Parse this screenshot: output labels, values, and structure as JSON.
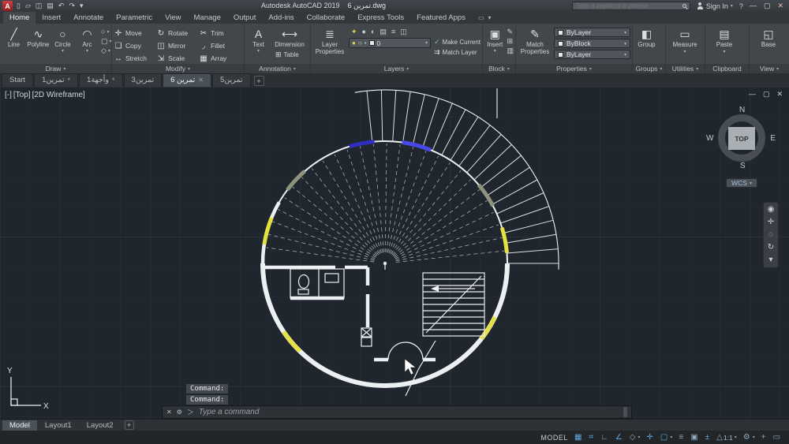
{
  "ui": {
    "caret": "▾",
    "close": "✕",
    "plus": "+"
  },
  "colors": {
    "canvas_bg": "#20262d",
    "wall_white": "#edf0f2",
    "segment_yellow": "#e6e13e",
    "segment_blue": "#4748e8",
    "segment_navy": "#2e2ec0",
    "segment_gray": "#8f927e",
    "status_active": "#62a6df"
  },
  "title_bar": {
    "logo_letter": "A",
    "qat_icons": [
      {
        "glyph": "▯"
      },
      {
        "glyph": "▱"
      },
      {
        "glyph": "◫"
      },
      {
        "glyph": "▤"
      },
      {
        "glyph": "↶"
      },
      {
        "glyph": "↷"
      },
      {
        "glyph": "▾"
      }
    ],
    "app_title": "Autodesk AutoCAD 2019",
    "doc_title": "تمرين 6.dwg",
    "search_placeholder": "Type a keyword or phrase",
    "sign_in_label": "Sign In",
    "help_glyph": "?",
    "window_buttons": {
      "minimize": "—",
      "restore": "▢",
      "close": "✕"
    }
  },
  "ribbon_tabs": [
    {
      "label": "Home",
      "active": true
    },
    {
      "label": "Insert"
    },
    {
      "label": "Annotate"
    },
    {
      "label": "Parametric"
    },
    {
      "label": "View"
    },
    {
      "label": "Manage"
    },
    {
      "label": "Output"
    },
    {
      "label": "Add-ins"
    },
    {
      "label": "Collaborate"
    },
    {
      "label": "Express Tools"
    },
    {
      "label": "Featured Apps"
    }
  ],
  "panels": {
    "draw": {
      "label": "Draw",
      "items": [
        {
          "label": "Line",
          "glyph": "╱"
        },
        {
          "label": "Polyline",
          "glyph": "∿"
        },
        {
          "label": "Circle",
          "glyph": "○",
          "caret": true
        },
        {
          "label": "Arc",
          "glyph": "◠",
          "caret": true
        }
      ],
      "extra_icons": [
        {
          "glyph": "○"
        },
        {
          "glyph": "▢"
        },
        {
          "glyph": "◇"
        }
      ]
    },
    "modify": {
      "label": "Modify",
      "items": [
        {
          "label": "Move",
          "glyph": "✛"
        },
        {
          "label": "Rotate",
          "glyph": "↻"
        },
        {
          "label": "Trim",
          "glyph": "✂"
        },
        {
          "label": "Copy",
          "glyph": "❏"
        },
        {
          "label": "Mirror",
          "glyph": "◫"
        },
        {
          "label": "Fillet",
          "glyph": "◞"
        },
        {
          "label": "Stretch",
          "glyph": "↔"
        },
        {
          "label": "Scale",
          "glyph": "⇲"
        },
        {
          "label": "Array",
          "glyph": "▦"
        }
      ]
    },
    "annotation": {
      "label": "Annotation",
      "text": {
        "label": "Text",
        "glyph": "A",
        "caret": true
      },
      "dimension": {
        "label": "Dimension",
        "glyph": "⟷",
        "caret": true
      },
      "table": {
        "label": "Table",
        "glyph": "⊞"
      }
    },
    "layers": {
      "label": "Layers",
      "layer_properties": {
        "label": "Layer Properties",
        "glyph": "≣"
      },
      "tool_icons": [
        {
          "glyph": "✦"
        },
        {
          "glyph": "●"
        },
        {
          "glyph": "◐"
        },
        {
          "glyph": "▤"
        },
        {
          "glyph": "≡"
        },
        {
          "glyph": "◫"
        }
      ],
      "layer_dropdown": {
        "value": "0",
        "bulb_glyph": "●",
        "sun_glyph": "○",
        "lock_glyph": "▪"
      },
      "make_current": {
        "label": "Make Current",
        "glyph": "✓"
      },
      "match_layer": {
        "label": "Match Layer",
        "glyph": "⇉"
      }
    },
    "block": {
      "label": "Block",
      "insert": {
        "label": "Insert",
        "glyph": "▣",
        "caret": true
      },
      "extra_icons": [
        {
          "glyph": "✎"
        },
        {
          "glyph": "⊞"
        },
        {
          "glyph": "▥"
        }
      ]
    },
    "properties": {
      "label": "Properties",
      "match_properties": {
        "label": "Match Properties",
        "glyph": "✎"
      },
      "dropdowns": [
        {
          "label": "ByLayer"
        },
        {
          "label": "ByBlock"
        },
        {
          "label": "ByLayer"
        }
      ]
    },
    "groups": {
      "label": "Groups",
      "group": {
        "label": "Group",
        "glyph": "◧"
      }
    },
    "utilities": {
      "label": "Utilities",
      "measure": {
        "label": "Measure",
        "glyph": "▭",
        "caret": true
      }
    },
    "clipboard": {
      "label": "Clipboard",
      "paste": {
        "label": "Paste",
        "glyph": "▤",
        "caret": true
      }
    },
    "view": {
      "label": "View",
      "base": {
        "label": "Base",
        "glyph": "◱"
      }
    }
  },
  "file_tabs": [
    {
      "label": "Start"
    },
    {
      "label": "تمرين1",
      "suffix": "*"
    },
    {
      "label": "وأجهة1",
      "suffix": "*"
    },
    {
      "label": "تمرين3"
    },
    {
      "label": "تمرين 6",
      "active": true
    },
    {
      "label": "تمرين5"
    }
  ],
  "viewport": {
    "controls": [
      {
        "label": "[-]"
      },
      {
        "label": "[Top]"
      },
      {
        "label": "[2D Wireframe]"
      }
    ],
    "window_buttons": [
      {
        "glyph": "—"
      },
      {
        "glyph": "▢"
      },
      {
        "glyph": "✕"
      }
    ],
    "viewcube": {
      "north": "N",
      "south": "S",
      "east": "E",
      "west": "W",
      "top": "TOP",
      "wcs": "WCS"
    },
    "navbar_icons": [
      {
        "glyph": "◉"
      },
      {
        "glyph": "✛"
      },
      {
        "glyph": "◌"
      },
      {
        "glyph": "↻"
      },
      {
        "glyph": "▾"
      }
    ]
  },
  "command": {
    "history": [
      {
        "text": "Command:"
      },
      {
        "text": "Command:"
      }
    ],
    "prompt_placeholder": "Type a command",
    "close_glyph": "✕",
    "customize_glyph": "⚙",
    "prompt_glyph": "＞"
  },
  "layout_tabs": [
    {
      "label": "Model",
      "active": true
    },
    {
      "label": "Layout1"
    },
    {
      "label": "Layout2"
    }
  ],
  "status_bar": {
    "model_label": "MODEL",
    "icons": [
      {
        "glyph": "▦",
        "active": true
      },
      {
        "glyph": "⌗",
        "active": true
      },
      {
        "glyph": "∟"
      },
      {
        "glyph": "∠",
        "active": true
      },
      {
        "glyph": "◇",
        "caret": true
      },
      {
        "glyph": "✛",
        "active": true
      },
      {
        "glyph": "▢",
        "active": true,
        "caret": true
      },
      {
        "glyph": "≡"
      },
      {
        "glyph": "▣"
      },
      {
        "glyph": "±",
        "active": true
      },
      {
        "label": "1:1",
        "glyph": "△",
        "caret": true
      },
      {
        "glyph": "⚙",
        "caret": true
      },
      {
        "glyph": "+"
      },
      {
        "glyph": "▭"
      }
    ]
  },
  "ucs": {
    "x_label": "X",
    "y_label": "Y"
  }
}
